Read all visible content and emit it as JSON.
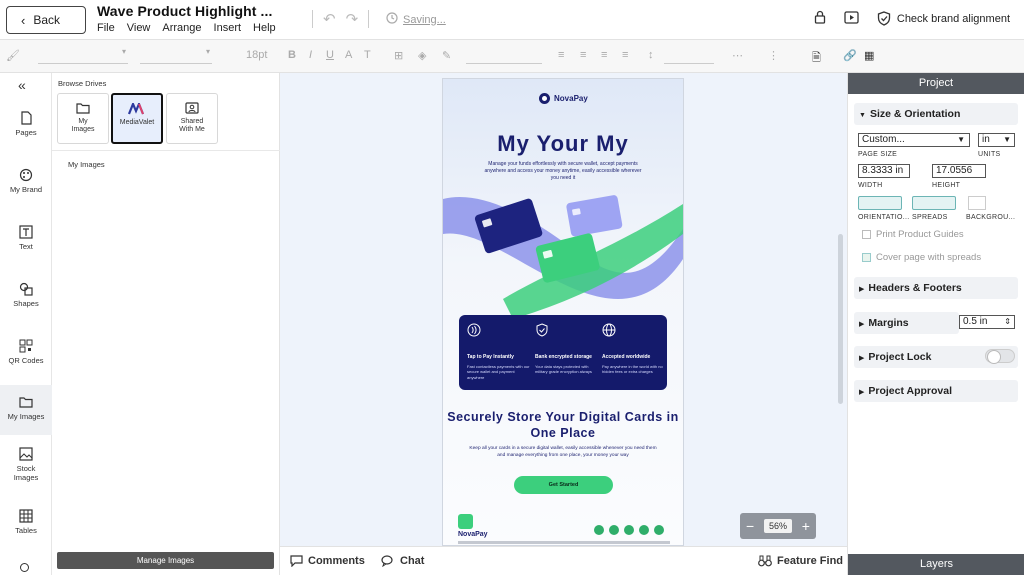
{
  "header": {
    "back_label": "Back",
    "doc_title": "Wave Product Highlight ...",
    "menu": [
      "File",
      "View",
      "Arrange",
      "Insert",
      "Help"
    ],
    "saving_label": "Saving...",
    "check_brand_label": "Check brand alignment"
  },
  "toolbar": {
    "font_size": "18pt",
    "style_buttons": [
      "B",
      "I",
      "U",
      "A",
      "T"
    ]
  },
  "rail": {
    "items": [
      {
        "label": "Pages",
        "icon": "page-icon"
      },
      {
        "label": "My Brand",
        "icon": "palette-icon"
      },
      {
        "label": "Text",
        "icon": "text-icon"
      },
      {
        "label": "Shapes",
        "icon": "shapes-icon"
      },
      {
        "label": "QR Codes",
        "icon": "qr-icon"
      },
      {
        "label": "My Images",
        "icon": "folder-icon"
      },
      {
        "label": "Stock Images",
        "icon": "image-icon"
      },
      {
        "label": "Tables",
        "icon": "table-icon"
      }
    ]
  },
  "images_panel": {
    "browse_label": "Browse Drives",
    "drives": [
      {
        "label": "My Images"
      },
      {
        "label": "MediaValet"
      },
      {
        "label": "Shared With Me"
      }
    ],
    "section_label": "My Images",
    "manage_label": "Manage Images"
  },
  "canvas": {
    "zoom": "56%",
    "page": {
      "logo": "NovaPay",
      "hero_title": "My Your My",
      "hero_sub": "Manage your funds effortlessly with secure wallet, accept payments anywhere and access your money anytime, easily accessible wherever you need it",
      "features": [
        {
          "title": "Tap to Pay Instantly",
          "desc": "Fast contactless payments with our secure wallet and payment anywhere"
        },
        {
          "title": "Bank encrypted storage",
          "desc": "Your data stays protected with military grade encryption always"
        },
        {
          "title": "Accepted worldwide",
          "desc": "Pay anywhere in the world with no hidden fees or extra charges"
        }
      ],
      "section_title": "Securely Store Your Digital Cards in One Place",
      "section_sub": "Keep all your cards in a secure digital wallet, easily accessible whenever you need them and manage everything from one place, your money your way",
      "cta": "Get Started",
      "footer_logo": "NovaPay"
    }
  },
  "properties": {
    "title": "Project",
    "size_section": "Size & Orientation",
    "page_size_value": "Custom...",
    "page_size_label": "PAGE SIZE",
    "units_value": "in",
    "units_label": "UNITS",
    "width_value": "8.3333 in",
    "width_label": "WIDTH",
    "height_value": "17.0556",
    "height_label": "HEIGHT",
    "orientation_label": "ORIENTATIO...",
    "spreads_label": "SPREADS",
    "background_label": "BACKGROU...",
    "guides_label": "Print Product Guides",
    "cover_label": "Cover page with spreads",
    "headers_section": "Headers & Footers",
    "margins_section": "Margins",
    "margins_value": "0.5 in",
    "lock_section": "Project Lock",
    "approval_section": "Project Approval",
    "layers_label": "Layers"
  },
  "bottombar": {
    "comments_label": "Comments",
    "chat_label": "Chat",
    "feature_find_label": "Feature Find"
  }
}
